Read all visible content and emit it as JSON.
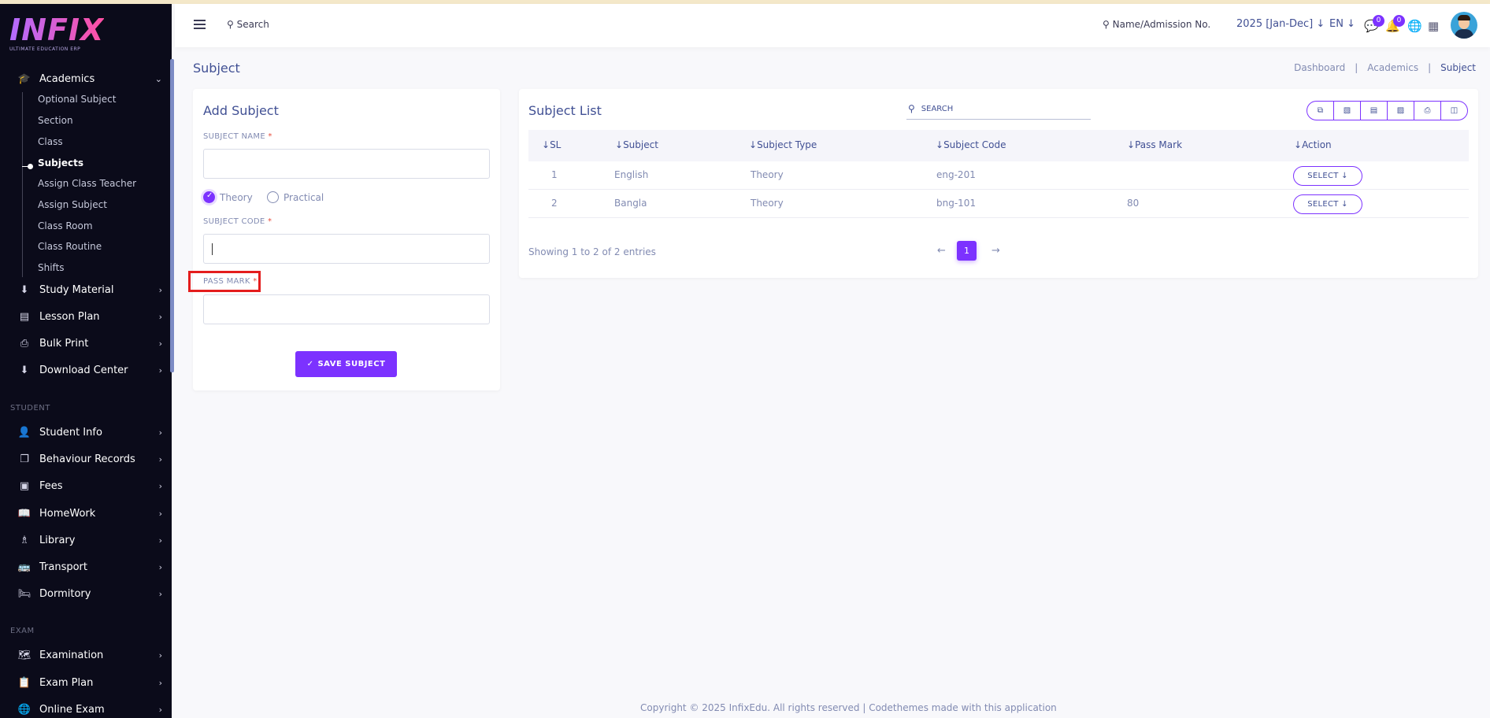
{
  "brand": {
    "logo": "INFIX",
    "tagline": "ULTIMATE EDUCATION ERP"
  },
  "sidebar": {
    "academics": {
      "label": "Academics",
      "items": [
        "Optional Subject",
        "Section",
        "Class",
        "Subjects",
        "Assign Class Teacher",
        "Assign Subject",
        "Class Room",
        "Class Routine",
        "Shifts"
      ],
      "active": "Subjects"
    },
    "menu1": [
      "Study Material",
      "Lesson Plan",
      "Bulk Print",
      "Download Center"
    ],
    "student_label": "STUDENT",
    "menu2": [
      "Student Info",
      "Behaviour Records",
      "Fees",
      "HomeWork",
      "Library",
      "Transport",
      "Dormitory"
    ],
    "exam_label": "EXAM",
    "menu3": [
      "Examination",
      "Exam Plan",
      "Online Exam"
    ]
  },
  "header": {
    "search": "Search",
    "name_search": "Name/Admission No.",
    "session": "2025 [Jan-Dec]",
    "language": "EN",
    "chat_badge": "0",
    "notify_badge": "0"
  },
  "page": {
    "title": "Subject",
    "breadcrumb": [
      "Dashboard",
      "Academics",
      "Subject"
    ]
  },
  "form": {
    "title": "Add Subject",
    "subject_name_label": "SUBJECT NAME",
    "subject_name_value": "",
    "type_options": [
      "Theory",
      "Practical"
    ],
    "selected_type": "Theory",
    "subject_code_label": "SUBJECT CODE",
    "subject_code_value": "",
    "pass_mark_label": "PASS MARK",
    "pass_mark_value": "",
    "required_mark": "*",
    "save_label": "SAVE SUBJECT"
  },
  "list": {
    "title": "Subject List",
    "search_placeholder": "SEARCH",
    "columns": [
      "SL",
      "Subject",
      "Subject Type",
      "Subject Code",
      "Pass Mark",
      "Action"
    ],
    "rows": [
      {
        "sl": "1",
        "subject": "English",
        "type": "Theory",
        "code": "eng-201",
        "pass_mark": "",
        "action": "SELECT"
      },
      {
        "sl": "2",
        "subject": "Bangla",
        "type": "Theory",
        "code": "bng-101",
        "pass_mark": "80",
        "action": "SELECT"
      }
    ],
    "showing": "Showing 1 to 2 of 2 entries",
    "current_page": "1"
  },
  "footer": "Copyright © 2025 InfixEdu. All rights reserved | Codethemes made with this application"
}
